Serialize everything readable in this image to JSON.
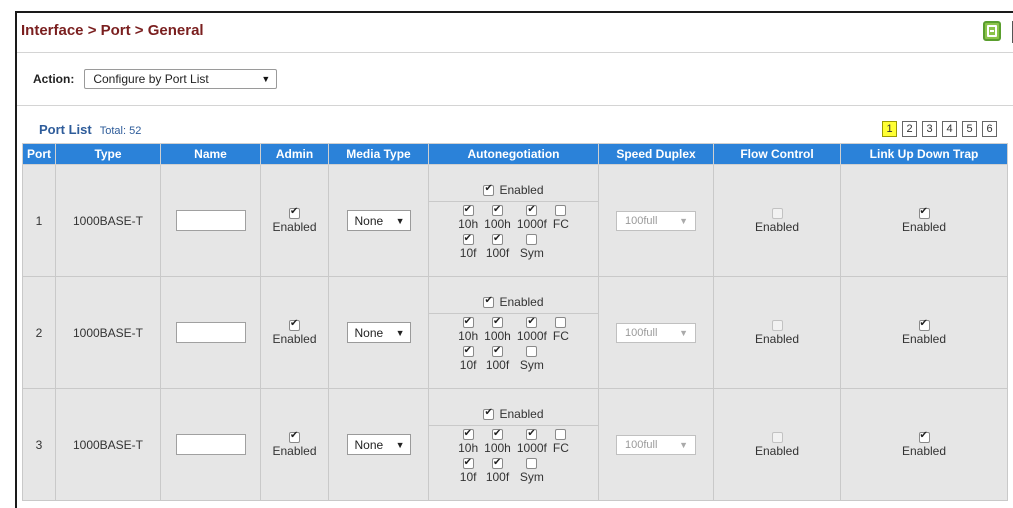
{
  "page": {
    "title": "Interface > Port > General"
  },
  "action": {
    "label": "Action:",
    "selected": "Configure by Port List"
  },
  "port_list": {
    "title": "Port List",
    "total": "Total: 52"
  },
  "pages": [
    "1",
    "2",
    "3",
    "4",
    "5",
    "6"
  ],
  "active_page": "1",
  "columns": [
    "Port",
    "Type",
    "Name",
    "Admin",
    "Media Type",
    "Autonegotiation",
    "Speed Duplex",
    "Flow Control",
    "Link Up Down Trap"
  ],
  "rows": [
    {
      "port": "1",
      "type": "1000BASE-T",
      "name": "",
      "admin": {
        "checked": true,
        "label": "Enabled"
      },
      "media": "None",
      "auto": {
        "enabled": {
          "checked": true,
          "label": "Enabled"
        },
        "cols": [
          [
            {
              "label": "10h",
              "checked": true
            },
            {
              "label": "10f",
              "checked": true
            }
          ],
          [
            {
              "label": "100h",
              "checked": true
            },
            {
              "label": "100f",
              "checked": true
            }
          ],
          [
            {
              "label": "1000f",
              "checked": true
            },
            {
              "label": "Sym",
              "checked": false
            }
          ],
          [
            {
              "label": "FC",
              "checked": false
            }
          ]
        ]
      },
      "speed": "100full",
      "flow": {
        "checked": false,
        "label": "Enabled"
      },
      "trap": {
        "checked": true,
        "label": "Enabled"
      }
    },
    {
      "port": "2",
      "type": "1000BASE-T",
      "name": "",
      "admin": {
        "checked": true,
        "label": "Enabled"
      },
      "media": "None",
      "auto": {
        "enabled": {
          "checked": true,
          "label": "Enabled"
        },
        "cols": [
          [
            {
              "label": "10h",
              "checked": true
            },
            {
              "label": "10f",
              "checked": true
            }
          ],
          [
            {
              "label": "100h",
              "checked": true
            },
            {
              "label": "100f",
              "checked": true
            }
          ],
          [
            {
              "label": "1000f",
              "checked": true
            },
            {
              "label": "Sym",
              "checked": false
            }
          ],
          [
            {
              "label": "FC",
              "checked": false
            }
          ]
        ]
      },
      "speed": "100full",
      "flow": {
        "checked": false,
        "label": "Enabled"
      },
      "trap": {
        "checked": true,
        "label": "Enabled"
      }
    },
    {
      "port": "3",
      "type": "1000BASE-T",
      "name": "",
      "admin": {
        "checked": true,
        "label": "Enabled"
      },
      "media": "None",
      "auto": {
        "enabled": {
          "checked": true,
          "label": "Enabled"
        },
        "cols": [
          [
            {
              "label": "10h",
              "checked": true
            },
            {
              "label": "10f",
              "checked": true
            }
          ],
          [
            {
              "label": "100h",
              "checked": true
            },
            {
              "label": "100f",
              "checked": true
            }
          ],
          [
            {
              "label": "1000f",
              "checked": true
            },
            {
              "label": "Sym",
              "checked": false
            }
          ],
          [
            {
              "label": "FC",
              "checked": false
            }
          ]
        ]
      },
      "speed": "100full",
      "flow": {
        "checked": false,
        "label": "Enabled"
      },
      "trap": {
        "checked": true,
        "label": "Enabled"
      }
    }
  ],
  "icons": {
    "save": "save-icon",
    "dropdown": "chevron-down-icon",
    "checkbox": "checkbox-icon"
  },
  "colors": {
    "header_bg": "#2b82d9",
    "title": "#7a1f1f",
    "list_title": "#2e5c9a",
    "row_bg": "#e6e6e6",
    "active_page": "#ffff33"
  }
}
